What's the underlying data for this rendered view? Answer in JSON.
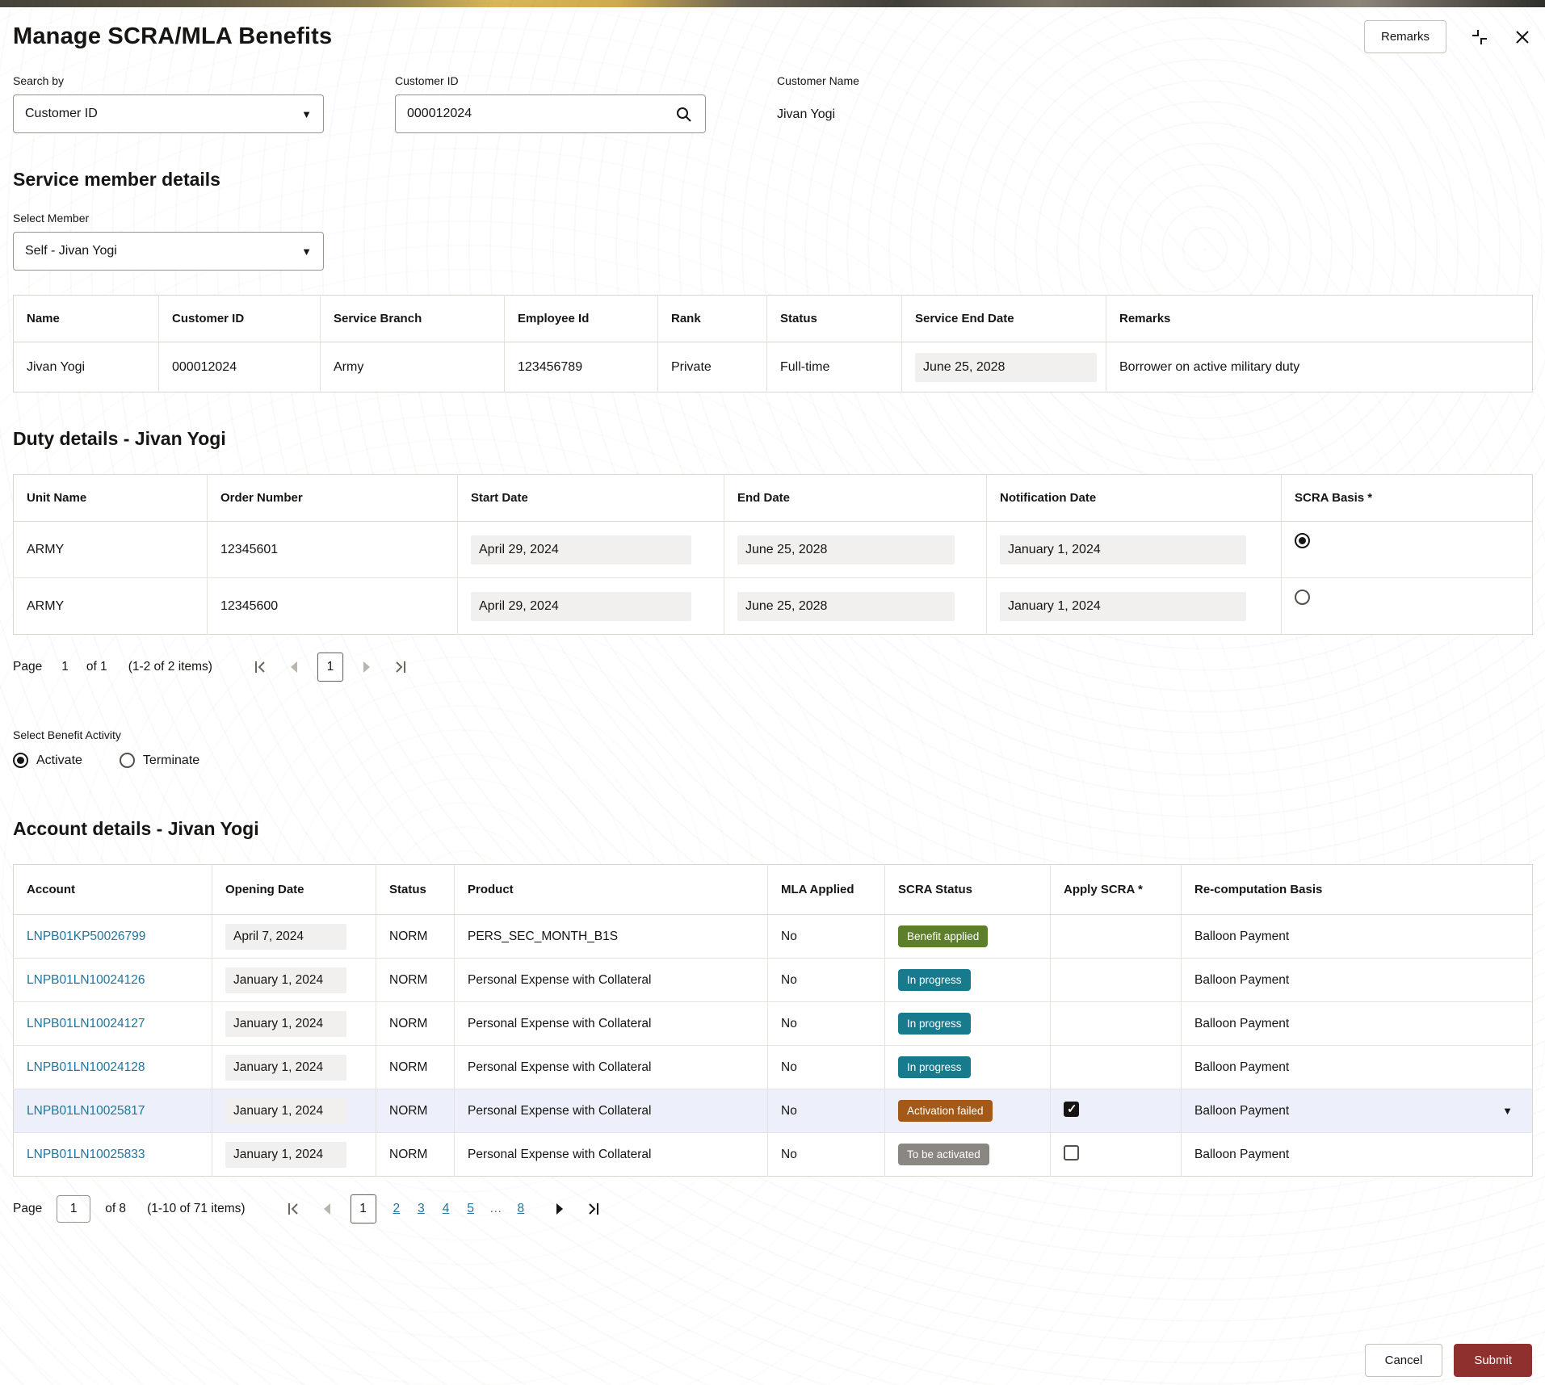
{
  "colors": {
    "badge_success": "#5d7e2a",
    "badge_info": "#187a8d",
    "badge_warn": "#a35a18",
    "badge_neutral": "#8a8682",
    "submit": "#90302e",
    "link": "#21749e",
    "highlight_row": "#edf0fa"
  },
  "header": {
    "title": "Manage SCRA/MLA Benefits",
    "remarks_label": "Remarks"
  },
  "search": {
    "by_label": "Search by",
    "by_value": "Customer ID",
    "cust_id_label": "Customer ID",
    "cust_id_value": "000012024",
    "cust_name_label": "Customer Name",
    "cust_name_value": "Jivan Yogi"
  },
  "member": {
    "title": "Service member details",
    "select_label": "Select Member",
    "select_value": "Self - Jivan Yogi",
    "headers": [
      "Name",
      "Customer ID",
      "Service Branch",
      "Employee Id",
      "Rank",
      "Status",
      "Service End Date",
      "Remarks"
    ],
    "row": {
      "name": "Jivan Yogi",
      "customer_id": "000012024",
      "service_branch": "Army",
      "employee_id": "123456789",
      "rank": "Private",
      "status": "Full-time",
      "service_end_date": "June 25, 2028",
      "remarks": "Borrower on active military duty"
    }
  },
  "duty": {
    "title": "Duty details - Jivan Yogi",
    "headers": [
      "Unit Name",
      "Order Number",
      "Start Date",
      "End Date",
      "Notification Date",
      "SCRA Basis *"
    ],
    "rows": [
      {
        "unit_name": "ARMY",
        "order_number": "12345601",
        "start_date": "April 29, 2024",
        "end_date": "June 25, 2028",
        "notification_date": "January 1, 2024",
        "scra_basis_selected": true
      },
      {
        "unit_name": "ARMY",
        "order_number": "12345600",
        "start_date": "April 29, 2024",
        "end_date": "June 25, 2028",
        "notification_date": "January 1, 2024",
        "scra_basis_selected": false
      }
    ],
    "pagination": {
      "page_label": "Page",
      "page_value": "1",
      "of_label": "of 1",
      "items_label": "(1-2 of 2 items)",
      "current_page": "1"
    }
  },
  "activity": {
    "label": "Select Benefit Activity",
    "options": [
      {
        "label": "Activate",
        "selected": true
      },
      {
        "label": "Terminate",
        "selected": false
      }
    ]
  },
  "accounts": {
    "title": "Account details - Jivan Yogi",
    "headers": [
      "Account",
      "Opening Date",
      "Status",
      "Product",
      "MLA Applied",
      "SCRA Status",
      "Apply SCRA *",
      "Re-computation Basis"
    ],
    "rows": [
      {
        "account": "LNPB01KP50026799",
        "opening_date": "April 7, 2024",
        "status": "NORM",
        "product": "PERS_SEC_MONTH_B1S",
        "mla_applied": "No",
        "scra_status": "Benefit applied",
        "recomputation": "Balloon Payment"
      },
      {
        "account": "LNPB01LN10024126",
        "opening_date": "January 1, 2024",
        "status": "NORM",
        "product": "Personal Expense with Collateral",
        "mla_applied": "No",
        "scra_status": "In progress",
        "recomputation": "Balloon Payment"
      },
      {
        "account": "LNPB01LN10024127",
        "opening_date": "January 1, 2024",
        "status": "NORM",
        "product": "Personal Expense with Collateral",
        "mla_applied": "No",
        "scra_status": "In progress",
        "recomputation": "Balloon Payment"
      },
      {
        "account": "LNPB01LN10024128",
        "opening_date": "January 1, 2024",
        "status": "NORM",
        "product": "Personal Expense with Collateral",
        "mla_applied": "No",
        "scra_status": "In progress",
        "recomputation": "Balloon Payment"
      },
      {
        "account": "LNPB01LN10025817",
        "opening_date": "January 1, 2024",
        "status": "NORM",
        "product": "Personal Expense with Collateral",
        "mla_applied": "No",
        "scra_status": "Activation failed",
        "recomputation": "Balloon Payment"
      },
      {
        "account": "LNPB01LN10025833",
        "opening_date": "January 1, 2024",
        "status": "NORM",
        "product": "Personal Expense with Collateral",
        "mla_applied": "No",
        "scra_status": "To be activated",
        "recomputation": "Balloon Payment"
      }
    ],
    "pagination": {
      "page_label": "Page",
      "page_value": "1",
      "of_label": "of 8",
      "items_label": "(1-10 of 71 items)",
      "pages": [
        "1",
        "2",
        "3",
        "4",
        "5",
        "…",
        "8"
      ]
    }
  },
  "footer": {
    "cancel_label": "Cancel",
    "submit_label": "Submit"
  }
}
